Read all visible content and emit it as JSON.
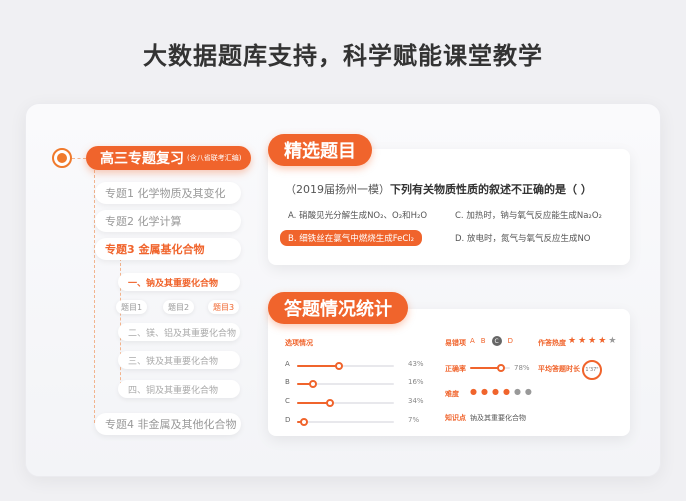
{
  "headline": "大数据题库支持，科学赋能课堂教学",
  "tree": {
    "root_main": "高三专题复习",
    "root_sub": "(含八省联考汇编)",
    "topics": [
      {
        "label": "专题1 化学物质及其变化"
      },
      {
        "label": "专题2 化学计算"
      },
      {
        "label": "专题3 金属基化合物"
      },
      {
        "label": "专题4 非金属及其他化合物"
      }
    ],
    "subtopics": [
      {
        "label": "一、钠及其重要化合物"
      },
      {
        "label": "二、镁、铝及其重要化合物"
      },
      {
        "label": "三、铁及其重要化合物"
      },
      {
        "label": "四、铜及其重要化合物"
      }
    ],
    "tags": [
      "题目1",
      "题目2",
      "题目3"
    ]
  },
  "question_card": {
    "title": "精选题目",
    "source": "（2019届扬州一模）",
    "stem": "下列有关物质性质的叙述不正确的是（     ）",
    "options": {
      "A": "A. 硝酸见光分解生成NO₂、O₂和H₂O",
      "B": "B. 细铁丝在氯气中燃烧生成FeCl₂",
      "C": "C. 加热时，钠与氧气反应能生成Na₂O₂",
      "D": "D. 放电时，氮气与氧气反应生成NO"
    }
  },
  "stats_card": {
    "title": "答题情况统计",
    "options_label": "选项情况",
    "bars": [
      {
        "letter": "A",
        "percent": 43,
        "text": "43%"
      },
      {
        "letter": "B",
        "percent": 16,
        "text": "16%"
      },
      {
        "letter": "C",
        "percent": 34,
        "text": "34%"
      },
      {
        "letter": "D",
        "percent": 7,
        "text": "7%"
      }
    ],
    "wrong_label": "易错项",
    "answer_letters": [
      "A",
      "B",
      "C",
      "D"
    ],
    "correct_rate_label": "正确率",
    "correct_rate": 78,
    "correct_rate_text": "78%",
    "difficulty_label": "难度",
    "difficulty_level": 4,
    "difficulty_max": 6,
    "knowledge_label": "知识点",
    "knowledge_value": "钠及其重要化合物",
    "popularity_label": "作答热度",
    "popularity_stars": 4,
    "popularity_max": 5,
    "avg_time_label": "平均答题时长",
    "avg_time_value": "1'37\""
  },
  "colors": {
    "accent": "#f0642c",
    "muted": "#999999"
  }
}
